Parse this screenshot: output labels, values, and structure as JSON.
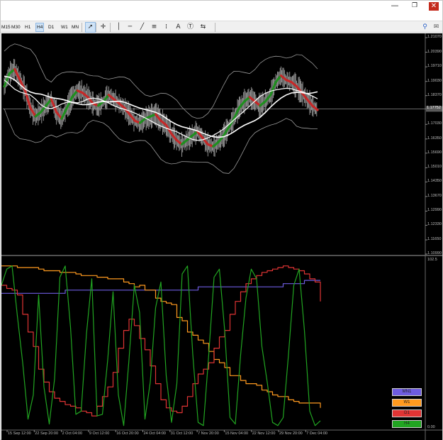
{
  "window": {
    "minimize_glyph": "—",
    "maximize_glyph": "❐",
    "close_glyph": "✕"
  },
  "toolbar": {
    "timeframes": [
      {
        "label": "M15",
        "active": false
      },
      {
        "label": "M30",
        "active": false
      },
      {
        "label": "H1",
        "active": false
      },
      {
        "label": "H4",
        "active": true
      },
      {
        "label": "D1",
        "active": false
      },
      {
        "label": "W1",
        "active": false
      },
      {
        "label": "MN",
        "active": false
      }
    ],
    "tools": [
      {
        "name": "cursor-icon",
        "glyph": "➚",
        "active": true
      },
      {
        "name": "crosshair-icon",
        "glyph": "✛",
        "active": false
      },
      {
        "name": "vertical-line-icon",
        "glyph": "│",
        "active": false
      },
      {
        "name": "horizontal-line-icon",
        "glyph": "─",
        "active": false
      },
      {
        "name": "trendline-icon",
        "glyph": "╱",
        "active": false
      },
      {
        "name": "channel-icon",
        "glyph": "≡",
        "active": false
      },
      {
        "name": "fibonacci-icon",
        "glyph": "⁞",
        "active": false
      },
      {
        "name": "text-icon",
        "glyph": "A",
        "active": false
      },
      {
        "name": "text-label-icon",
        "glyph": "Ⓣ",
        "active": false
      },
      {
        "name": "shapes-menu-icon",
        "glyph": "⇆",
        "active": false
      }
    ],
    "search_glyph": "⚲",
    "chat_glyph": "✉"
  },
  "price_axis": {
    "labels": [
      "1.21070",
      "1.20390",
      "1.19710",
      "1.19030",
      "1.18370",
      "1.17752",
      "1.17030",
      "1.16350",
      "1.15690",
      "1.15010",
      "1.14350",
      "1.13670",
      "1.12990",
      "1.12330",
      "1.11650",
      "1.10990"
    ],
    "current_price": "1.17752",
    "range": [
      1.1099,
      1.2107
    ]
  },
  "indicator_axis": {
    "top": "102.5",
    "bottom": "0.00"
  },
  "time_axis": {
    "labels": [
      "15 Sep 12:00",
      "22 Sep 20:00",
      "2 Oct 04:00",
      "9 Oct 12:00",
      "16 Oct 20:00",
      "24 Oct 04:00",
      "31 Oct 12:00",
      "7 Nov 20:00",
      "15 Nov 04:00",
      "22 Nov 12:00",
      "29 Nov 20:00",
      "7 Dec 04:00"
    ]
  },
  "legend": [
    {
      "label": "MN1",
      "color": "#6e5ce0"
    },
    {
      "label": "W1",
      "color": "#ff9a1f"
    },
    {
      "label": "D1",
      "color": "#e03434"
    },
    {
      "label": "H4",
      "color": "#21a521"
    }
  ],
  "colors": {
    "background": "#000000",
    "price_bars": "#a0a0a0",
    "bullish": "#1f8f1f",
    "bearish": "#c62828",
    "moving_average": "#ffffff",
    "bollinger": "#9a9a9a",
    "grid_separator": "#7a7a7a"
  },
  "chart_data": [
    {
      "type": "line",
      "title": "",
      "ylim": [
        1.1099,
        1.2107
      ],
      "x": [
        0,
        1,
        2,
        3,
        4,
        5,
        6,
        7,
        8,
        9,
        10,
        11,
        12,
        13,
        14,
        15,
        16,
        17,
        18,
        19,
        20,
        21,
        22,
        23,
        24,
        25,
        26,
        27,
        28,
        29,
        30,
        31,
        32,
        33,
        34,
        35,
        36,
        37,
        38,
        39,
        40,
        41,
        42,
        43,
        44,
        45,
        46,
        47,
        48,
        49,
        50,
        51,
        52,
        53,
        54,
        55,
        56,
        57,
        58,
        59,
        60
      ],
      "series": [
        {
          "values": [
            1.188,
            1.194,
            1.196,
            1.191,
            1.186,
            1.178,
            1.174,
            1.176,
            1.179,
            1.182,
            1.176,
            1.173,
            1.178,
            1.183,
            1.186,
            1.185,
            1.183,
            1.18,
            1.179,
            1.181,
            1.184,
            1.182,
            1.18,
            1.178,
            1.175,
            1.172,
            1.171,
            1.173,
            1.174,
            1.175,
            1.172,
            1.17,
            1.166,
            1.163,
            1.161,
            1.163,
            1.165,
            1.167,
            1.164,
            1.161,
            1.16,
            1.162,
            1.165,
            1.169,
            1.173,
            1.178,
            1.181,
            1.183,
            1.181,
            1.179,
            1.181,
            1.184,
            1.19,
            1.193,
            1.191,
            1.19,
            1.188,
            1.185,
            1.182,
            1.179,
            1.177
          ]
        }
      ]
    },
    {
      "type": "line",
      "title": "",
      "ylim": [
        0,
        102.5
      ],
      "x": [
        0,
        1,
        2,
        3,
        4,
        5,
        6,
        7,
        8,
        9,
        10,
        11,
        12,
        13,
        14,
        15,
        16,
        17,
        18,
        19,
        20,
        21,
        22,
        23,
        24,
        25,
        26,
        27,
        28,
        29,
        30,
        31,
        32,
        33,
        34,
        35,
        36,
        37,
        38,
        39,
        40,
        41,
        42,
        43,
        44,
        45,
        46,
        47,
        48,
        49,
        50,
        51,
        52,
        53,
        54,
        55,
        56,
        57,
        58,
        59,
        60
      ],
      "series": [
        {
          "name": "MN1",
          "values": [
            83,
            83,
            83,
            83,
            83,
            83,
            83,
            83,
            83,
            83,
            83,
            83,
            85,
            85,
            85,
            85,
            85,
            85,
            85,
            85,
            85,
            85,
            85,
            85,
            85,
            85,
            85,
            85,
            85,
            85,
            85,
            85,
            85,
            85,
            85,
            85,
            85,
            87,
            87,
            87,
            87,
            87,
            87,
            87,
            87,
            87,
            87,
            87,
            87,
            87,
            87,
            87,
            87,
            89,
            89,
            89,
            89,
            91,
            91,
            91,
            91
          ]
        },
        {
          "name": "W1",
          "values": [
            100,
            100,
            100,
            99,
            99,
            99,
            99,
            98,
            97,
            97,
            97,
            96,
            96,
            96,
            95,
            94,
            94,
            94,
            93,
            93,
            92,
            92,
            92,
            90,
            89,
            87,
            88,
            85,
            85,
            80,
            78,
            77,
            76,
            68,
            66,
            59,
            57,
            54,
            52,
            47,
            42,
            40,
            37,
            32,
            32,
            29,
            27,
            27,
            26,
            23,
            22,
            20,
            19,
            19,
            17,
            16,
            15,
            15,
            15,
            15,
            12
          ]
        },
        {
          "name": "D1",
          "values": [
            88,
            86,
            85,
            82,
            70,
            59,
            50,
            36,
            28,
            22,
            18,
            16,
            14,
            13,
            12,
            10,
            9,
            7,
            13,
            19,
            25,
            34,
            49,
            60,
            67,
            63,
            55,
            48,
            38,
            27,
            17,
            12,
            10,
            9,
            13,
            19,
            27,
            33,
            36,
            40,
            49,
            56,
            60,
            70,
            78,
            84,
            89,
            92,
            94,
            96,
            97,
            98,
            99,
            100,
            99,
            98,
            97,
            95,
            92,
            90,
            78
          ]
        },
        {
          "name": "H4",
          "values": [
            88,
            98,
            100,
            69,
            40,
            5,
            20,
            82,
            25,
            2,
            30,
            93,
            100,
            62,
            8,
            10,
            58,
            92,
            7,
            8,
            42,
            84,
            20,
            1,
            42,
            88,
            71,
            5,
            28,
            74,
            90,
            32,
            3,
            27,
            95,
            100,
            45,
            3,
            1,
            45,
            93,
            98,
            60,
            6,
            2,
            45,
            80,
            98,
            92,
            50,
            28,
            3,
            1,
            6,
            45,
            88,
            98,
            60,
            10,
            1,
            4
          ]
        }
      ]
    }
  ]
}
